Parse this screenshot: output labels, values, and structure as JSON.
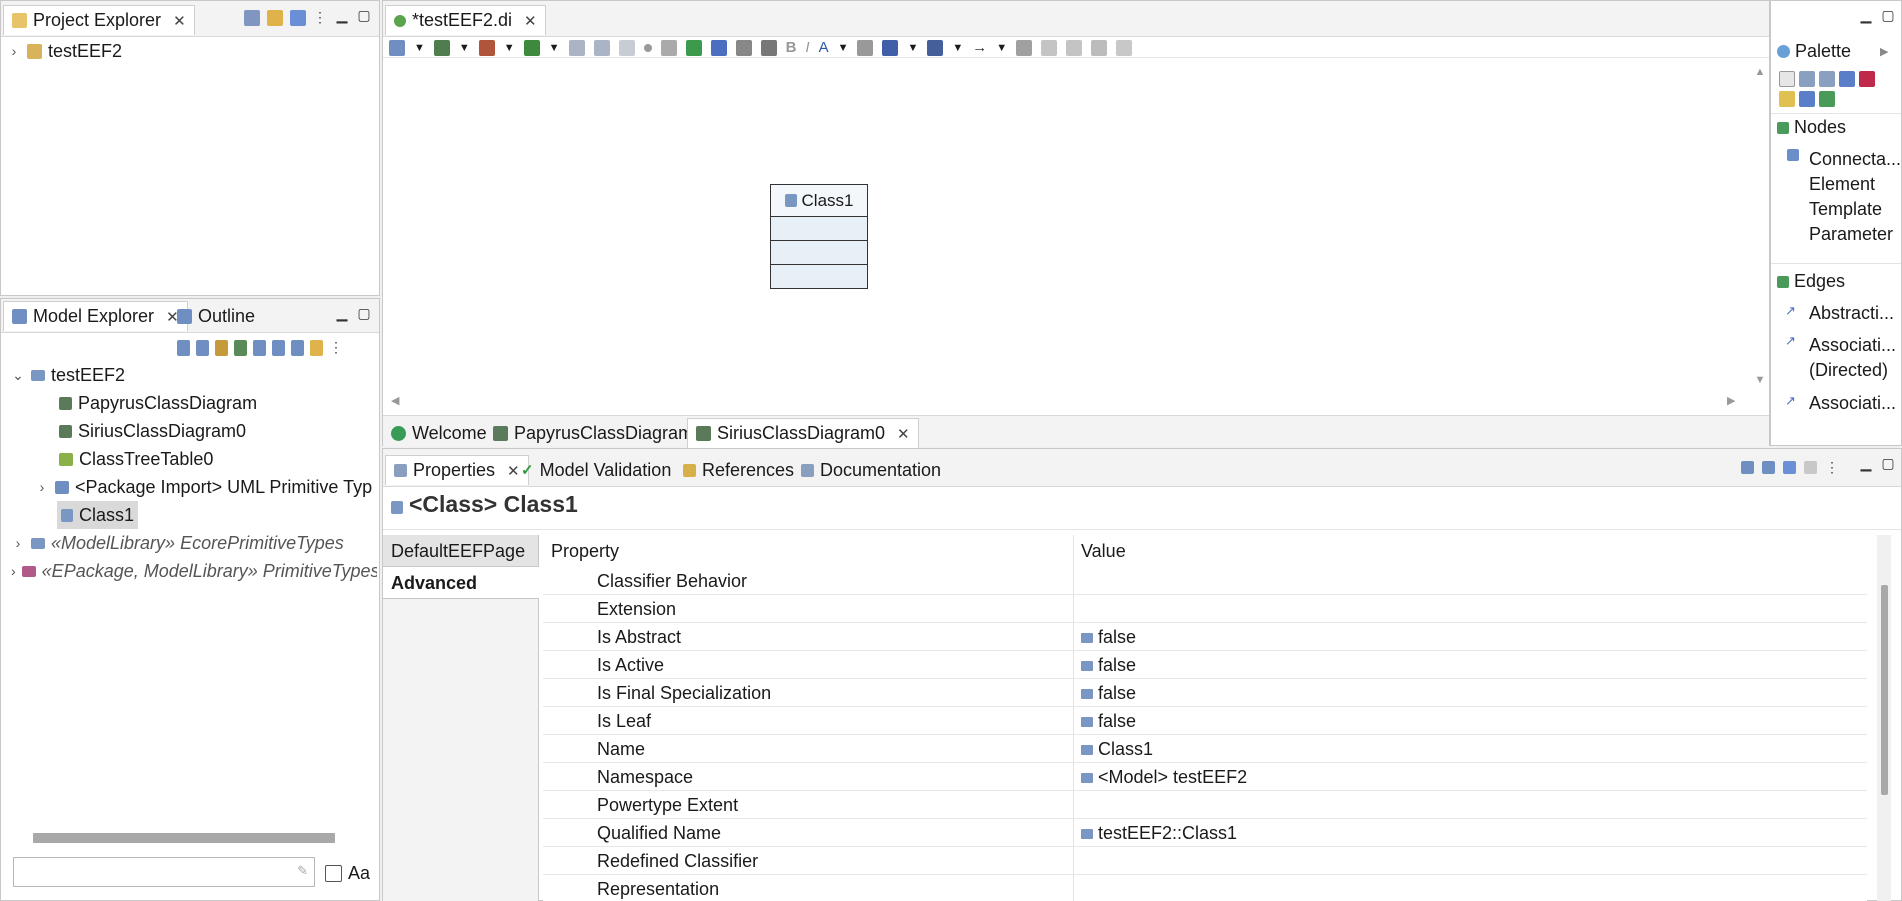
{
  "project_explorer": {
    "tab_label": "Project Explorer",
    "items": [
      {
        "label": "testEEF2"
      }
    ]
  },
  "editor": {
    "tab_label": "*testEEF2.di",
    "class_box_label": "Class1",
    "bottom_tabs": [
      "Welcome",
      "PapyrusClassDiagram",
      "SiriusClassDiagram0"
    ]
  },
  "palette": {
    "title": "Palette",
    "nodes_label": "Nodes",
    "node_items": [
      "Connecta...",
      "Element",
      "Template",
      "Parameter"
    ],
    "edges_label": "Edges",
    "edge_items": [
      "Abstracti...",
      "Associati...",
      "(Directed)",
      "Associati..."
    ]
  },
  "model_explorer": {
    "tab_label": "Model Explorer",
    "outline_label": "Outline",
    "tree": [
      {
        "label": "testEEF2"
      },
      {
        "label": "PapyrusClassDiagram"
      },
      {
        "label": "SiriusClassDiagram0"
      },
      {
        "label": "ClassTreeTable0"
      },
      {
        "label": "<Package Import> UML Primitive Typ"
      },
      {
        "label": "Class1"
      },
      {
        "label": "«ModelLibrary» EcorePrimitiveTypes"
      },
      {
        "label": "«EPackage, ModelLibrary» PrimitiveTypes"
      }
    ],
    "filter_placeholder": "",
    "case_label": "Aa"
  },
  "properties": {
    "tabs": [
      "Properties",
      "Model Validation",
      "References",
      "Documentation"
    ],
    "title": "<Class> Class1",
    "pages": [
      "DefaultEEFPage",
      "Advanced"
    ],
    "col_property": "Property",
    "col_value": "Value",
    "rows": [
      {
        "name": "Classifier Behavior",
        "value": ""
      },
      {
        "name": "Extension",
        "value": ""
      },
      {
        "name": "Is Abstract",
        "value": "false"
      },
      {
        "name": "Is Active",
        "value": "false"
      },
      {
        "name": "Is Final Specialization",
        "value": "false"
      },
      {
        "name": "Is Leaf",
        "value": "false"
      },
      {
        "name": "Name",
        "value": "Class1"
      },
      {
        "name": "Namespace",
        "value": "<Model> testEEF2"
      },
      {
        "name": "Powertype Extent",
        "value": ""
      },
      {
        "name": "Qualified Name",
        "value": "testEEF2::Class1"
      },
      {
        "name": "Redefined Classifier",
        "value": ""
      },
      {
        "name": "Representation",
        "value": ""
      }
    ]
  },
  "colors": {
    "accent": "#2f6fd0",
    "selection": "#d9d9d9",
    "class_fill": "#e8f0f7"
  }
}
